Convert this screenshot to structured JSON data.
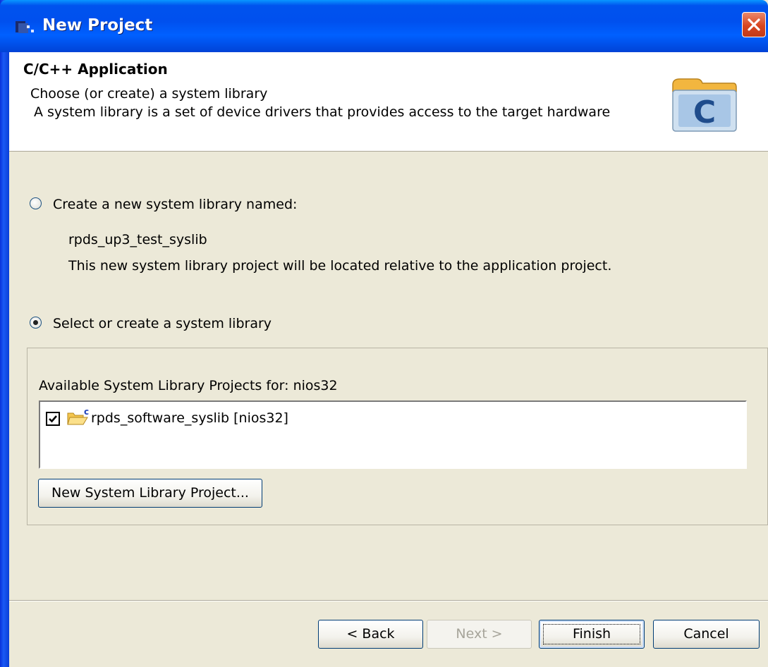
{
  "window": {
    "title": "New Project"
  },
  "header": {
    "title": "C/C++ Application",
    "subtitle": "Choose (or create) a system library",
    "description": "A system library is a set of device drivers that provides access to the target hardware",
    "icon_letter": "C"
  },
  "options": {
    "create_new": {
      "label": "Create a new system library named:",
      "selected": false,
      "library_name": "rpds_up3_test_syslib",
      "note": "This new system library project will be located relative to the application project."
    },
    "select_existing": {
      "label": "Select or create a system library",
      "selected": true
    }
  },
  "library_group": {
    "label": "Available System Library Projects for:  nios32",
    "items": [
      {
        "label": "rpds_software_syslib [nios32]",
        "checked": true
      }
    ],
    "new_button": "New System Library Project..."
  },
  "footer": {
    "back": "< Back",
    "next": "Next >",
    "finish": "Finish",
    "cancel": "Cancel"
  }
}
